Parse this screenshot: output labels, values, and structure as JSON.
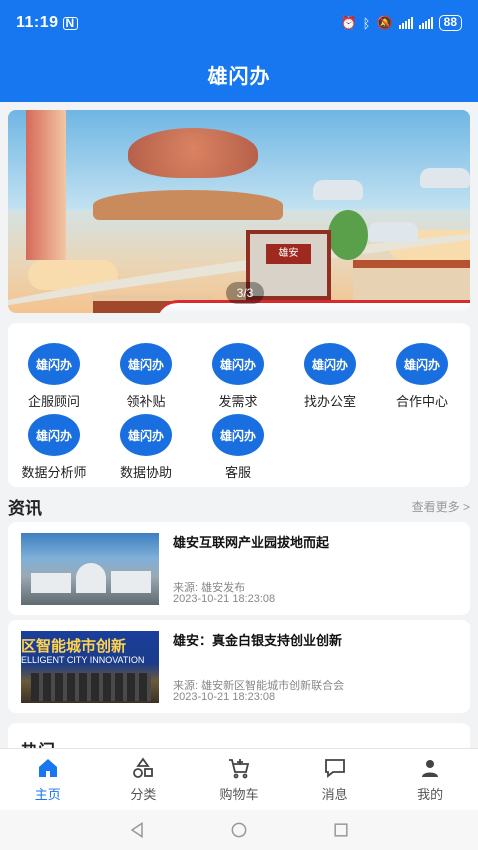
{
  "status_bar": {
    "time": "11:19",
    "battery": "88"
  },
  "header": {
    "title": "雄闪办"
  },
  "banner": {
    "pager": "3/3",
    "gate_sign": "雄安"
  },
  "services": [
    {
      "badge": "雄闪办",
      "label": "企服顾问"
    },
    {
      "badge": "雄闪办",
      "label": "领补贴"
    },
    {
      "badge": "雄闪办",
      "label": "发需求"
    },
    {
      "badge": "雄闪办",
      "label": "找办公室"
    },
    {
      "badge": "雄闪办",
      "label": "合作中心"
    },
    {
      "badge": "雄闪办",
      "label": "数据分析师"
    },
    {
      "badge": "雄闪办",
      "label": "数据协助"
    },
    {
      "badge": "雄闪办",
      "label": "客服"
    }
  ],
  "news": {
    "section_title": "资讯",
    "more_label": "查看更多 >",
    "items": [
      {
        "title": "雄安互联网产业园拔地而起",
        "source": "来源: 雄安发布",
        "time": "2023-10-21 18:23:08",
        "thumb_text": "",
        "thumb_subtext": ""
      },
      {
        "title": "雄安：真金白银支持创业创新",
        "source": "来源: 雄安新区智能城市创新联合会",
        "time": "2023-10-21 18:23:08",
        "thumb_text": "区智能城市创新",
        "thumb_subtext": "ELLIGENT CITY INNOVATION"
      }
    ]
  },
  "next_section_peek": "热门",
  "tabbar": [
    {
      "label": "主页",
      "icon": "home-icon",
      "active": true
    },
    {
      "label": "分类",
      "icon": "category-icon",
      "active": false
    },
    {
      "label": "购物车",
      "icon": "cart-icon",
      "active": false
    },
    {
      "label": "消息",
      "icon": "message-icon",
      "active": false
    },
    {
      "label": "我的",
      "icon": "person-icon",
      "active": false
    }
  ],
  "colors": {
    "primary": "#1677f0",
    "badge": "#1a6fe0",
    "background": "#f2f3f5"
  }
}
